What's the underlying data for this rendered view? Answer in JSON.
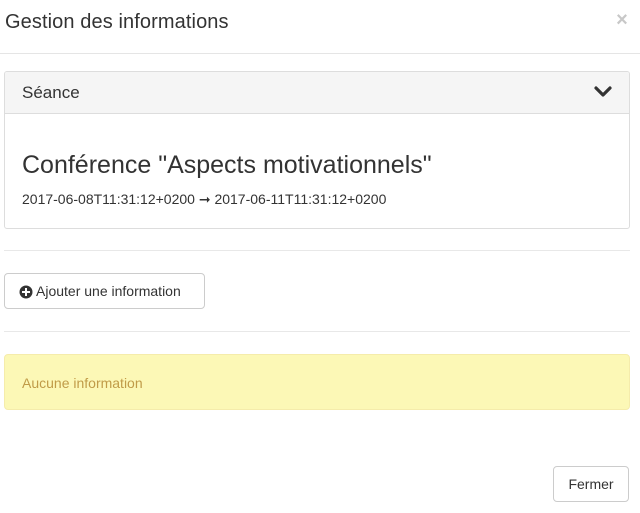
{
  "modal": {
    "title": "Gestion des informations",
    "close_symbol": "×"
  },
  "panel": {
    "heading": "Séance",
    "chevron_icon": "chevron-down-icon",
    "event_title": "Conférence \"Aspects motivationnels\"",
    "event_dates": "2017-06-08T11:31:12+0200 ➞ 2017-06-11T11:31:12+0200"
  },
  "actions": {
    "add_label": "Ajouter une information",
    "add_icon": "plus-circle-icon"
  },
  "alert": {
    "text": "Aucune information",
    "color": "#c09b48",
    "background": "#fcf8b6"
  },
  "footer": {
    "close_label": "Fermer"
  }
}
